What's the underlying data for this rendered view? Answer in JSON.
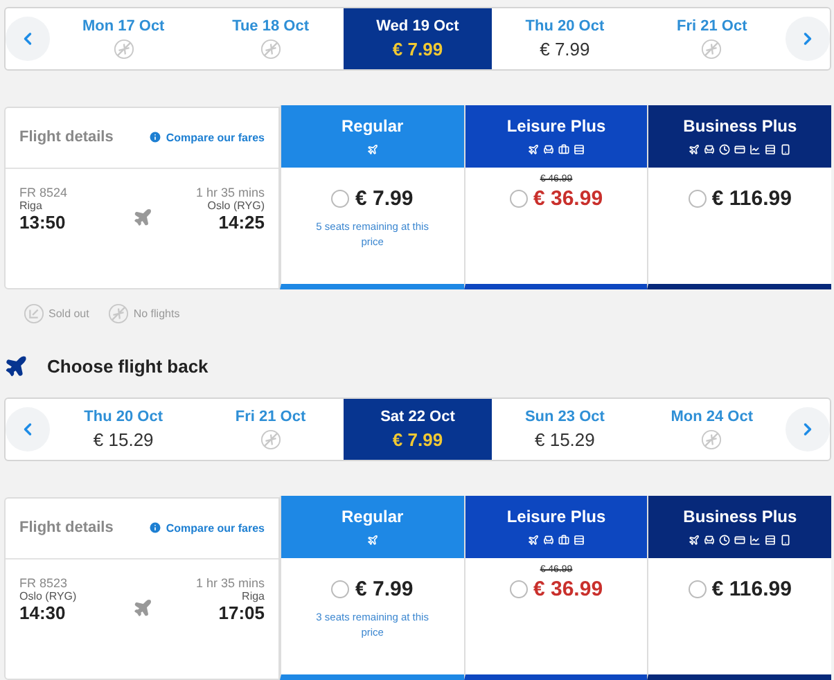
{
  "outbound": {
    "dates": [
      {
        "label": "Mon 17 Oct",
        "selected": false
      },
      {
        "label": "Tue 18 Oct",
        "selected": false
      },
      {
        "label": "Wed 19 Oct",
        "price": "€ 7.99",
        "selected": true
      },
      {
        "label": "Thu 20 Oct",
        "price": "€ 7.99",
        "selected": false
      },
      {
        "label": "Fri 21 Oct",
        "selected": false
      }
    ],
    "details_title": "Flight details",
    "compare_link": "Compare our fares",
    "flight": {
      "number": "FR 8524",
      "from": "Riga",
      "depart": "13:50",
      "duration": "1 hr 35 mins",
      "to": "Oslo (RYG)",
      "arrive": "14:25"
    },
    "fares": [
      {
        "kind": "regular",
        "name": "Regular",
        "price": "€ 7.99",
        "note": "5 seats remaining at this price",
        "selected": false
      },
      {
        "kind": "leisure",
        "name": "Leisure Plus",
        "old_price": "€ 46.99",
        "price": "€ 36.99",
        "selected": false
      },
      {
        "kind": "business",
        "name": "Business Plus",
        "price": "€ 116.99",
        "selected": false
      }
    ]
  },
  "legend": [
    {
      "kind": "sold_out",
      "label": "Sold out"
    },
    {
      "kind": "no_flights",
      "label": "No flights"
    }
  ],
  "return_heading": "Choose flight back",
  "return": {
    "dates": [
      {
        "label": "Thu 20 Oct",
        "price": "€ 15.29",
        "selected": false
      },
      {
        "label": "Fri 21 Oct",
        "selected": false
      },
      {
        "label": "Sat 22 Oct",
        "price": "€ 7.99",
        "selected": true
      },
      {
        "label": "Sun 23 Oct",
        "price": "€ 15.29",
        "selected": false
      },
      {
        "label": "Mon 24 Oct",
        "selected": false
      }
    ],
    "details_title": "Flight details",
    "compare_link": "Compare our fares",
    "flight": {
      "number": "FR 8523",
      "from": "Oslo (RYG)",
      "depart": "14:30",
      "duration": "1 hr 35 mins",
      "to": "Riga",
      "arrive": "17:05"
    },
    "fares": [
      {
        "kind": "regular",
        "name": "Regular",
        "price": "€ 7.99",
        "note": "3 seats remaining at this price",
        "selected": false
      },
      {
        "kind": "leisure",
        "name": "Leisure Plus",
        "old_price": "€ 46.99",
        "price": "€ 36.99",
        "selected": false
      },
      {
        "kind": "business",
        "name": "Business Plus",
        "price": "€ 116.99",
        "selected": false
      }
    ]
  }
}
